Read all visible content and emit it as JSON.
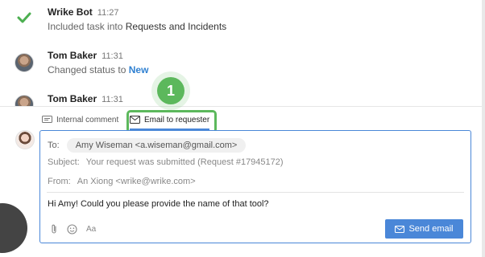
{
  "feed": [
    {
      "author": "Wrike Bot",
      "time": "11:27",
      "text_prefix": "Included task into ",
      "text_target": "Requests and Incidents",
      "avatar_icon": "wrike-check-icon"
    },
    {
      "author": "Tom Baker",
      "time": "11:31",
      "text_prefix": "Changed status to ",
      "text_target": "New",
      "avatar_icon": "user-avatar"
    },
    {
      "author": "Tom Baker",
      "time": "11:31",
      "avatar_icon": "user-avatar"
    }
  ],
  "step_badge": "1",
  "tabs": {
    "internal": {
      "label": "Internal comment",
      "icon": "comment-icon"
    },
    "email": {
      "label": "Email to requester",
      "icon": "envelope-icon",
      "selected": true
    }
  },
  "composer": {
    "to_label": "To:",
    "to_value": "Amy Wiseman <a.wiseman@gmail.com>",
    "subject_label": "Subject:",
    "subject_value": "Your request was submitted (Request #17945172)",
    "from_label": "From:",
    "from_value": "An Xiong <wrike@wrike.com>",
    "message": "Hi Amy! Could you please provide the name of that tool?",
    "toolbar": [
      {
        "icon": "paperclip-icon"
      },
      {
        "icon": "emoji-icon"
      },
      {
        "icon": "text-format-icon",
        "label": "Aa"
      }
    ],
    "send_label": "Send email"
  },
  "colors": {
    "accent": "#4a87d8",
    "highlight": "#5cb85c",
    "status_link": "#2f80d1"
  }
}
